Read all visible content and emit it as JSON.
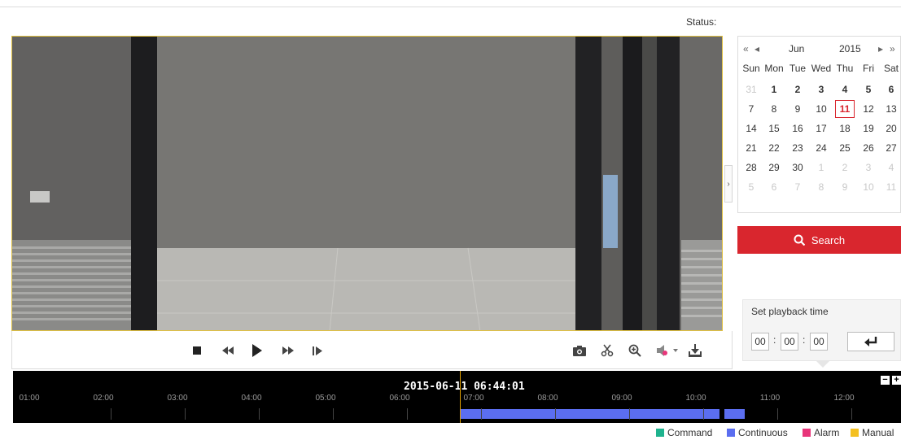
{
  "status": {
    "label": "Status:"
  },
  "player": {
    "controls": [
      {
        "name": "stop-icon"
      },
      {
        "name": "slow-forward-icon"
      },
      {
        "name": "play-icon"
      },
      {
        "name": "fast-forward-icon"
      },
      {
        "name": "single-frame-icon"
      }
    ],
    "tools": [
      {
        "name": "capture-icon"
      },
      {
        "name": "clip-icon"
      },
      {
        "name": "digital-zoom-icon"
      },
      {
        "name": "volume-icon"
      },
      {
        "name": "download-icon"
      }
    ]
  },
  "calendar": {
    "prev_year": "«",
    "prev_month": "◂",
    "month": "Jun",
    "year": "2015",
    "next_month": "▸",
    "next_year": "»",
    "weekdays": [
      "Sun",
      "Mon",
      "Tue",
      "Wed",
      "Thu",
      "Fri",
      "Sat"
    ],
    "weeks": [
      [
        "31",
        "1",
        "2",
        "3",
        "4",
        "5",
        "6"
      ],
      [
        "7",
        "8",
        "9",
        "10",
        "11",
        "12",
        "13"
      ],
      [
        "14",
        "15",
        "16",
        "17",
        "18",
        "19",
        "20"
      ],
      [
        "21",
        "22",
        "23",
        "24",
        "25",
        "26",
        "27"
      ],
      [
        "28",
        "29",
        "30",
        "1",
        "2",
        "3",
        "4"
      ],
      [
        "5",
        "6",
        "7",
        "8",
        "9",
        "10",
        "11"
      ]
    ],
    "selected_day": "11",
    "accent": "#d9262e"
  },
  "search": {
    "label": "Search"
  },
  "playback_time": {
    "title": "Set playback time",
    "hour": "00",
    "minute": "00",
    "second": "00",
    "sep": ":"
  },
  "timeline": {
    "current": "2015-06-11 06:44:01",
    "ticks": [
      "01:00",
      "02:00",
      "03:00",
      "04:00",
      "05:00",
      "06:00",
      "07:00",
      "08:00",
      "09:00",
      "10:00",
      "11:00",
      "12:00"
    ],
    "zoom_out": "−",
    "zoom_in": "+",
    "record_color": "#5b6ef0"
  },
  "legend": [
    {
      "label": "Command",
      "color": "#1fb38e"
    },
    {
      "label": "Continuous",
      "color": "#5b6ef0"
    },
    {
      "label": "Alarm",
      "color": "#e8357a"
    },
    {
      "label": "Manual",
      "color": "#f4c020"
    }
  ]
}
